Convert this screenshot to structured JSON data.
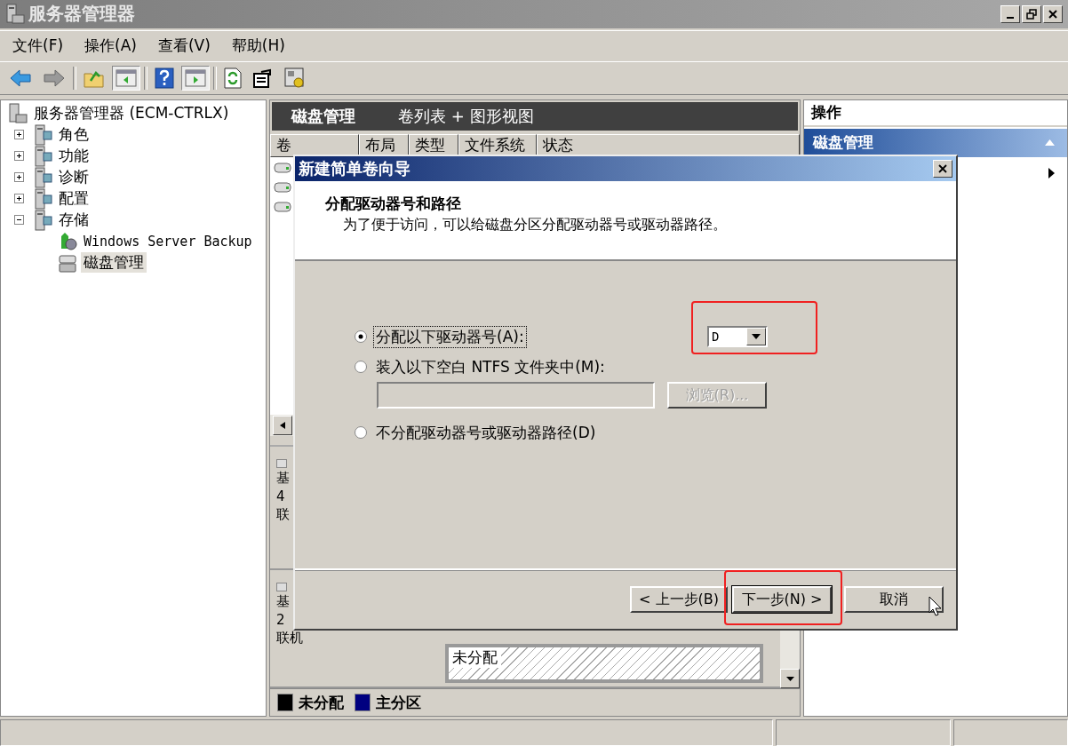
{
  "window": {
    "title": "服务器管理器"
  },
  "menu": [
    {
      "label": "文件(F)"
    },
    {
      "label": "操作(A)"
    },
    {
      "label": "查看(V)"
    },
    {
      "label": "帮助(H)"
    }
  ],
  "tree": {
    "label": "服务器管理器 (ECM-CTRLX)",
    "selected": false,
    "children": [
      {
        "label": "角色",
        "expanded": false,
        "selected": false
      },
      {
        "label": "功能",
        "expanded": false,
        "selected": false
      },
      {
        "label": "诊断",
        "expanded": false,
        "selected": false
      },
      {
        "label": "配置",
        "expanded": false,
        "selected": false
      },
      {
        "label": "存储",
        "expanded": true,
        "selected": false,
        "children": [
          {
            "label": "Windows Server Backup",
            "selected": false
          },
          {
            "label": "磁盘管理",
            "selected": true
          }
        ]
      }
    ]
  },
  "center": {
    "title": "磁盘管理",
    "subtitle": "卷列表 + 图形视图",
    "columns": [
      "卷",
      "布局",
      "类型",
      "文件系统",
      "状态"
    ],
    "disks": [
      {
        "name": "基",
        "size": "4",
        "status": "联"
      },
      {
        "name": "基",
        "size": "2",
        "status": "联机",
        "partition": "未分配"
      }
    ],
    "legend": [
      {
        "label": "未分配",
        "color": "#000000"
      },
      {
        "label": "主分区",
        "color": "#000080"
      }
    ]
  },
  "actions": {
    "title": "操作",
    "section": "磁盘管理",
    "expanded": true
  },
  "dialog": {
    "title": "新建简单卷向导",
    "heading": "分配驱动器号和路径",
    "description": "为了便于访问，可以给磁盘分区分配驱动器号或驱动器路径。",
    "options": [
      {
        "label": "分配以下驱动器号(A):",
        "selected": true
      },
      {
        "label": "装入以下空白 NTFS 文件夹中(M):",
        "selected": false
      },
      {
        "label": "不分配驱动器号或驱动器路径(D)",
        "selected": false
      }
    ],
    "drive_letter": {
      "value": "D",
      "highlighted": true
    },
    "folder_path": {
      "disabled": true
    },
    "browse": {
      "label": "浏览(R)...",
      "disabled": true
    },
    "buttons": [
      {
        "label": "< 上一步(B)",
        "default": false,
        "highlighted": false
      },
      {
        "label": "下一步(N) >",
        "default": true,
        "highlighted": true
      },
      {
        "label": "取消",
        "default": false,
        "highlighted": false
      }
    ]
  }
}
